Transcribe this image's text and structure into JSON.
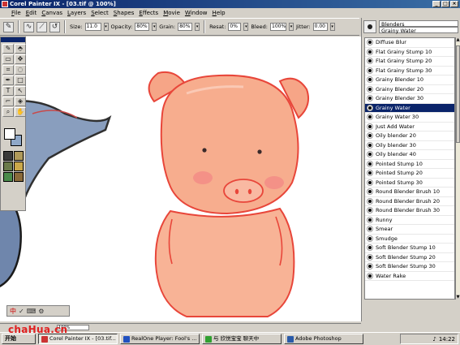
{
  "window": {
    "title": "Corel Painter IX - [03.tif @ 100%]",
    "controls": [
      "_",
      "□",
      "×"
    ]
  },
  "menubar": {
    "items": [
      {
        "key": "F",
        "rest": "ile"
      },
      {
        "key": "E",
        "rest": "dit"
      },
      {
        "key": "C",
        "rest": "anvas"
      },
      {
        "key": "L",
        "rest": "ayers"
      },
      {
        "key": "S",
        "rest": "elect"
      },
      {
        "key": "S",
        "rest": "hapes"
      },
      {
        "key": "E",
        "rest": "ffects"
      },
      {
        "key": "M",
        "rest": "ovie"
      },
      {
        "key": "W",
        "rest": "indow"
      },
      {
        "key": "H",
        "rest": "elp"
      }
    ]
  },
  "property_bar": {
    "size_label": "Size:",
    "size_value": "11.0",
    "opacity_label": "Opacity:",
    "opacity_value": "80%",
    "grain_label": "Grain:",
    "grain_value": "80%",
    "resat_label": "Resat:",
    "resat_value": "0%",
    "bleed_label": "Bleed:",
    "bleed_value": "100%",
    "jitter_label": "Jitter:",
    "jitter_value": "0.00"
  },
  "brush_panel": {
    "category": "Blenders",
    "variant": "Grainy Water",
    "items": [
      "Diffuse Blur",
      "Flat Grainy Stump 10",
      "Flat Grainy Stump 20",
      "Flat Grainy Stump 30",
      "Grainy Blender 10",
      "Grainy Blender 20",
      "Grainy Blender 30",
      "Grainy Water",
      "Grainy Water 30",
      "Just Add Water",
      "Oily blender 20",
      "Oily blender 30",
      "Oily blender 40",
      "Pointed Stump 10",
      "Pointed Stump 20",
      "Pointed Stump 30",
      "Round Blender Brush 10",
      "Round Blender Brush 20",
      "Round Blender Brush 30",
      "Runny",
      "Smear",
      "Smudge",
      "Soft Blender Stump 10",
      "Soft Blender Stump 20",
      "Soft Blender Stump 30",
      "Water Rake"
    ],
    "selected_index": 7
  },
  "statusbar": {
    "zoom": "100%"
  },
  "ime": {
    "label": "中"
  },
  "taskbar": {
    "start": "开始",
    "tasks": [
      {
        "label": "Corel Painter IX - [03.tif...",
        "color": "#c33",
        "active": true
      },
      {
        "label": "RealOne Player: Fool's ...",
        "color": "#2050c0",
        "active": false
      },
      {
        "label": "与 欣悦宝宝 聊天中",
        "color": "#30a030",
        "active": false
      },
      {
        "label": "Adobe Photoshop",
        "color": "#2a5aa8",
        "active": false
      }
    ],
    "clock": "14:22"
  },
  "watermark": "chaHua.cn",
  "colors": {
    "title_bar": "#0a246a",
    "selection": "#0a246a",
    "pig_fill": "#f7a98a",
    "pig_line": "#e8463a"
  }
}
